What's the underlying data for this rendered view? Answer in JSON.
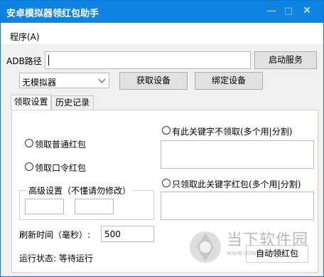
{
  "window": {
    "title": "安卓模拟器领红包助手",
    "min_glyph": "—",
    "max_glyph": "□",
    "close_glyph": "✕"
  },
  "menu": {
    "program": "程序(A)"
  },
  "adb": {
    "label": "ADB路径",
    "value": "",
    "start_service": "启动服务"
  },
  "emulator": {
    "selected": "无模拟器",
    "get_device": "获取设备",
    "bind_device": "绑定设备"
  },
  "tabs": [
    {
      "label": "领取设置"
    },
    {
      "label": "历史记录"
    }
  ],
  "settings": {
    "normal_packet": "领取普通红包",
    "password_packet": "领取口令红包",
    "exclude_keywords": "有此关键字不领取(多个用|分割)",
    "include_keywords": "只领取此关键字红包(多个用|分割)",
    "advanced": "高级设置（不懂请勿修改）",
    "refresh_label": "刷新时间（毫秒）:",
    "refresh_value": "500",
    "status_label": "运行状态: 等待运行",
    "auto_button": "自动领红包"
  },
  "watermark": {
    "text": "当下软件园",
    "url": "www.downxia.com"
  },
  "colors": {
    "titlebar": "#0f83e0",
    "panel": "#ffffff",
    "background": "#f0f0f0",
    "button": "#e1e1e1"
  }
}
